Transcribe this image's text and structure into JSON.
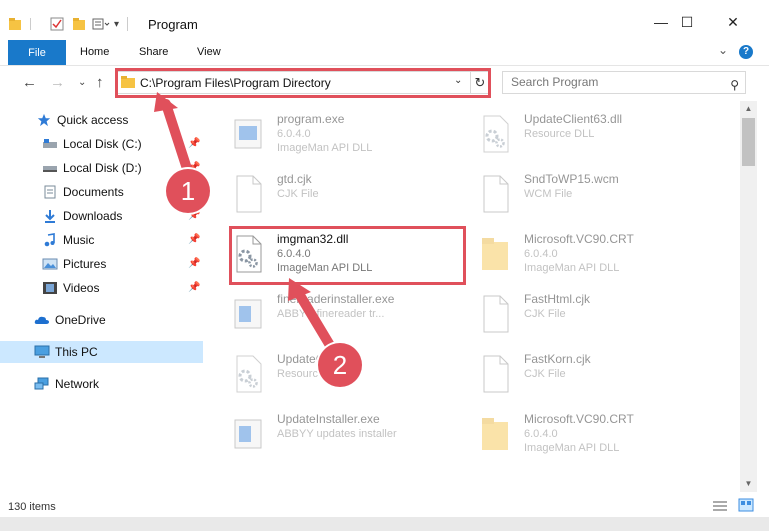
{
  "window": {
    "title": "Program",
    "minimize": "—",
    "maximize": "☐",
    "close": "✕"
  },
  "ribbon": {
    "tabs": [
      "File",
      "Home",
      "Share",
      "View"
    ],
    "collapse": "⌄",
    "help": "?"
  },
  "nav": {
    "back": "←",
    "forward": "→",
    "recent": "⌄",
    "up": "↑",
    "address": "C:\\Program Files\\Program Directory",
    "search_placeholder": "Search Program"
  },
  "sidebar": {
    "items": [
      {
        "label": "Quick access",
        "icon": "star-icon",
        "pinned": false
      },
      {
        "label": "Local Disk (C:)",
        "icon": "drive-icon",
        "pinned": true
      },
      {
        "label": "Local Disk (D:)",
        "icon": "drive-icon",
        "pinned": true
      },
      {
        "label": "Documents",
        "icon": "documents-icon",
        "pinned": true
      },
      {
        "label": "Downloads",
        "icon": "download-icon",
        "pinned": true
      },
      {
        "label": "Music",
        "icon": "music-icon",
        "pinned": true
      },
      {
        "label": "Pictures",
        "icon": "pictures-icon",
        "pinned": true
      },
      {
        "label": "Videos",
        "icon": "videos-icon",
        "pinned": true
      },
      {
        "label": "OneDrive",
        "icon": "onedrive-icon",
        "pinned": false
      },
      {
        "label": "This PC",
        "icon": "computer-icon",
        "pinned": false
      },
      {
        "label": "Network",
        "icon": "network-icon",
        "pinned": false
      }
    ]
  },
  "files": {
    "left": [
      {
        "name": "program.exe",
        "line2": "6.0.4.0",
        "line3": "ImageMan API DLL",
        "icon": "exe-icon",
        "faded": true
      },
      {
        "name": "gtd.cjk",
        "line2": "CJK File",
        "line3": "",
        "icon": "blank-file-icon",
        "faded": true
      },
      {
        "name": "imgman32.dll",
        "line2": "6.0.4.0",
        "line3": "ImageMan API DLL",
        "icon": "dll-gear-icon",
        "faded": false
      },
      {
        "name": "finereaderinstaller.exe",
        "line2": "ABBYY finereader tr...",
        "line3": "",
        "icon": "installer-icon",
        "faded": true
      },
      {
        "name": "UpdateClient.dll",
        "line2": "Resource DLL",
        "line3": "",
        "icon": "dll-gear-icon",
        "faded": true
      },
      {
        "name": "UpdateInstaller.exe",
        "line2": "ABBYY updates installer",
        "line3": "",
        "icon": "installer-icon",
        "faded": true
      }
    ],
    "right": [
      {
        "name": "UpdateClient63.dll",
        "line2": "Resource DLL",
        "line3": "",
        "icon": "dll-gear-icon",
        "faded": true
      },
      {
        "name": "SndToWP15.wcm",
        "line2": "WCM File",
        "line3": "",
        "icon": "blank-file-icon",
        "faded": true
      },
      {
        "name": "Microsoft.VC90.CRT",
        "line2": "6.0.4.0",
        "line3": "ImageMan API DLL",
        "icon": "folder-icon",
        "faded": true
      },
      {
        "name": "FastHtml.cjk",
        "line2": "CJK File",
        "line3": "",
        "icon": "blank-file-icon",
        "faded": true
      },
      {
        "name": "FastKorn.cjk",
        "line2": "CJK File",
        "line3": "",
        "icon": "blank-file-icon",
        "faded": true
      },
      {
        "name": "Microsoft.VC90.CRT",
        "line2": "6.0.4.0",
        "line3": "ImageMan API DLL",
        "icon": "folder-icon",
        "faded": true
      }
    ]
  },
  "status": {
    "count": "130 items"
  },
  "annotations": {
    "step1": "1",
    "step2": "2",
    "highlight_color": "#e0505b"
  }
}
